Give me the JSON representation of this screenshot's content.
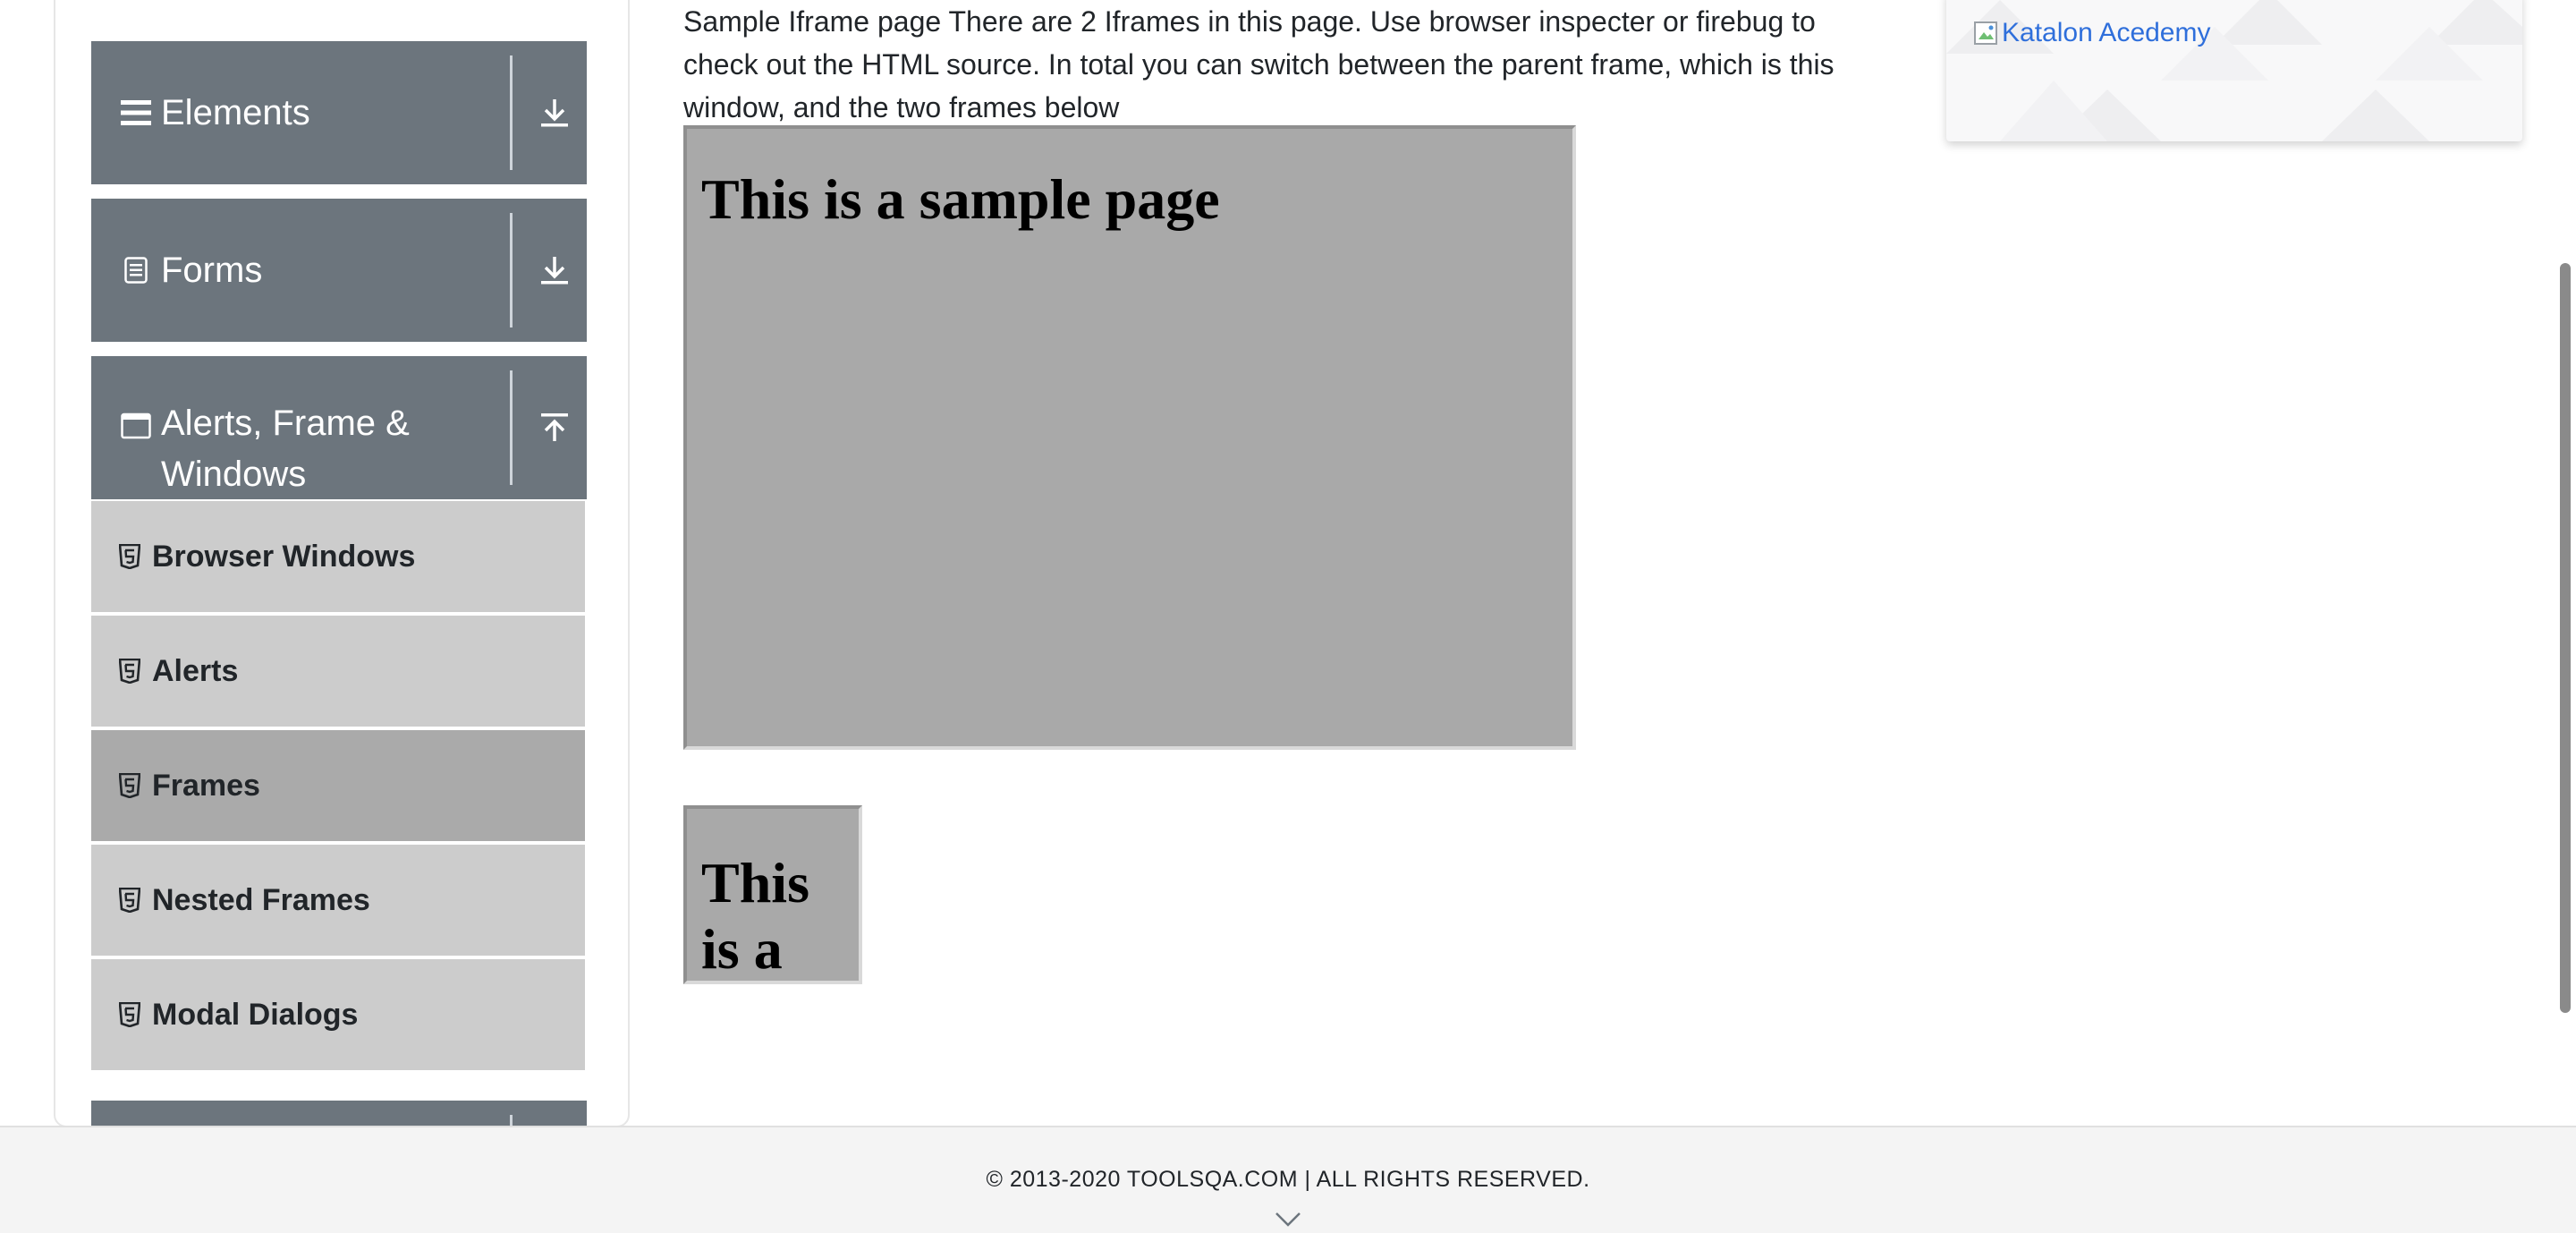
{
  "sidebar": {
    "groups": [
      {
        "label": "Elements",
        "icon": "hamburger-icon",
        "toggle_icon": "download-arrow-icon"
      },
      {
        "label": "Forms",
        "icon": "document-icon",
        "toggle_icon": "download-arrow-icon"
      },
      {
        "label_line1": "Alerts, Frame &",
        "label_line2": "Windows",
        "icon": "window-icon",
        "toggle_icon": "upload-arrow-icon"
      }
    ],
    "items": [
      {
        "label": "Browser Windows",
        "icon": "html5-icon",
        "active": false
      },
      {
        "label": "Alerts",
        "icon": "html5-icon",
        "active": false
      },
      {
        "label": "Frames",
        "icon": "html5-icon",
        "active": true
      },
      {
        "label": "Nested Frames",
        "icon": "html5-icon",
        "active": false
      },
      {
        "label": "Modal Dialogs",
        "icon": "html5-icon",
        "active": false
      }
    ]
  },
  "main": {
    "intro": "Sample Iframe page There are 2 Iframes in this page. Use browser inspecter or firebug to check out the HTML source. In total you can switch between the parent frame, which is this window, and the two frames below",
    "frame1": {
      "heading": "This is a sample page"
    },
    "frame2": {
      "heading": "This is a sample page"
    }
  },
  "ad": {
    "alt_text": "Katalon Acedemy"
  },
  "footer": {
    "text": "© 2013-2020 TOOLSQA.COM | ALL RIGHTS RESERVED."
  },
  "colors": {
    "group_header_bg": "#6c757d",
    "menu_item_bg": "#cccccc",
    "menu_item_active_bg": "#aaaaaa",
    "frame_bg": "#a9a9a9",
    "link": "#2f6fdb"
  }
}
